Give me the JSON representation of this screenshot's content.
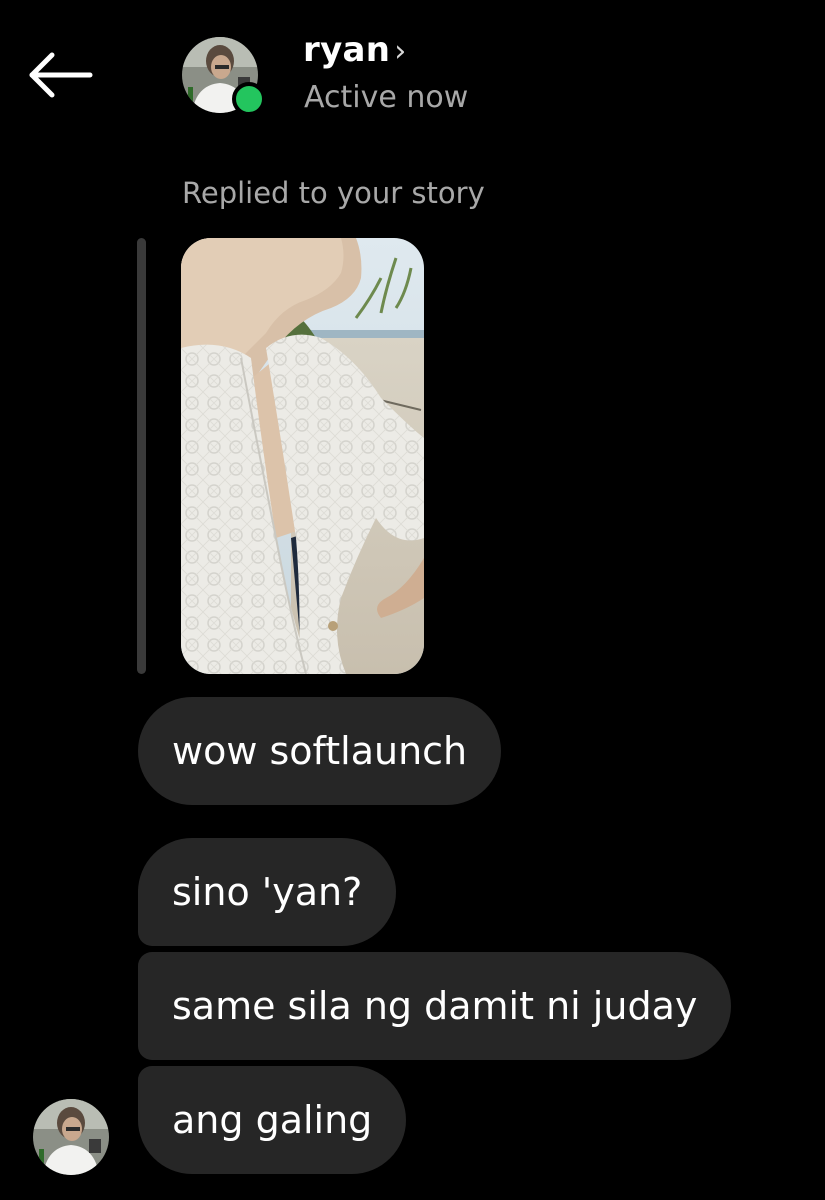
{
  "header": {
    "contact_name": "ryan",
    "chevron": "›",
    "status": "Active now",
    "back_icon": "arrow-left-icon",
    "online_indicator_color": "#23c55e"
  },
  "story_reply": {
    "caption": "Replied to your story",
    "thumbnail_icon": "story-photo"
  },
  "messages": [
    {
      "text": "wow softlaunch"
    },
    {
      "text": "sino 'yan?"
    },
    {
      "text": "same sila ng damit ni juday"
    },
    {
      "text": "ang galing"
    }
  ],
  "colors": {
    "background": "#000000",
    "bubble": "#262626",
    "secondary_text": "#a8a8a8"
  }
}
